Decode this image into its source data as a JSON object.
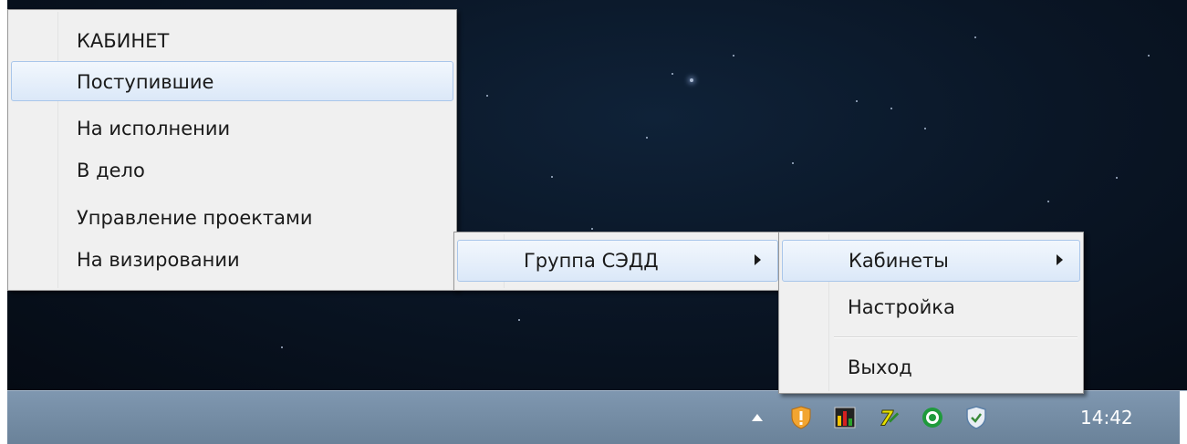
{
  "cabinet_menu": {
    "items": [
      {
        "label": "КАБИНЕТ"
      },
      {
        "label": "Поступившие"
      },
      {
        "label": "На исполнении"
      },
      {
        "label": "В дело"
      },
      {
        "label": "Управление проектами"
      },
      {
        "label": "На визировании"
      }
    ]
  },
  "group_menu": {
    "items": [
      {
        "label": "Группа СЭДД"
      }
    ]
  },
  "tray_menu": {
    "items": [
      {
        "label": "Кабинеты"
      },
      {
        "label": "Настройка"
      },
      {
        "label": "Выход"
      }
    ]
  },
  "taskbar": {
    "clock": "14:42",
    "tray_icons": [
      "show-hidden-icons-arrow-icon",
      "shield-warning-icon",
      "bar-chart-app-icon",
      "seven-app-icon",
      "green-target-icon",
      "security-shield-icon"
    ]
  },
  "colors": {
    "menu_bg": "#f0f0f0",
    "highlight": "#dbe8f8",
    "taskbar": "#7a92ab"
  }
}
